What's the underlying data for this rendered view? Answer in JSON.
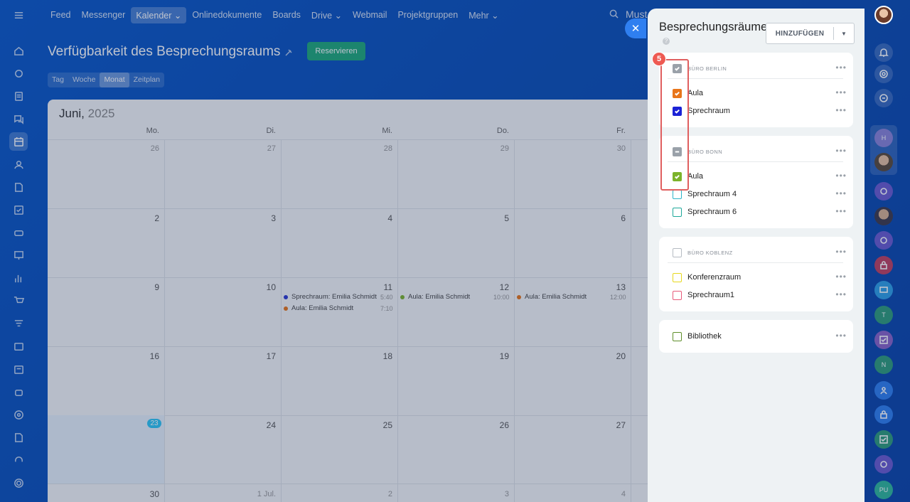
{
  "topnav": {
    "items": [
      {
        "label": "Feed"
      },
      {
        "label": "Messenger"
      },
      {
        "label": "Kalender ⌄",
        "active": true
      },
      {
        "label": "Onlinedokumente"
      },
      {
        "label": "Boards"
      },
      {
        "label": "Drive ⌄"
      },
      {
        "label": "Webmail"
      },
      {
        "label": "Projektgruppen"
      },
      {
        "label": "Mehr ⌄"
      }
    ],
    "search_text": "Must"
  },
  "page": {
    "title": "Verfügbarkeit des Besprechungsraums",
    "reserve_label": "Reservieren",
    "view_tabs": [
      "Tag",
      "Woche",
      "Monat",
      "Zeitplan"
    ],
    "active_view": "Monat"
  },
  "calendar": {
    "month": "Juni,",
    "year": "2025",
    "weekdays": [
      "Mo.",
      "Di.",
      "Mi.",
      "Do.",
      "Fr."
    ],
    "weeks": [
      [
        "26",
        "27",
        "28",
        "29",
        "30"
      ],
      [
        "2",
        "3",
        "4",
        "5",
        "6"
      ],
      [
        "9",
        "10",
        "11",
        "12",
        "13"
      ],
      [
        "16",
        "17",
        "18",
        "19",
        "20"
      ],
      [
        "23",
        "24",
        "25",
        "26",
        "27"
      ],
      [
        "30",
        "1 Jul.",
        "2",
        "3",
        "4"
      ]
    ],
    "today": "23",
    "events": [
      {
        "label": "Sprechraum: Emilia Schmidt",
        "time": "5:40",
        "color": "#2d3ad1"
      },
      {
        "label": "Aula: Emilia Schmidt",
        "time": "7:10",
        "color": "#e8751a"
      },
      {
        "label": "Aula: Emilia Schmidt",
        "time": "10:00",
        "color": "#7cb32b"
      },
      {
        "label": "Aula: Emilia Schmidt",
        "time": "12:00",
        "color": "#e8751a"
      }
    ]
  },
  "panel": {
    "title": "Besprechungsräume",
    "add_label": "HINZUFÜGEN",
    "step_number": "5",
    "sections": [
      {
        "name": "BÜRO BERLIN",
        "state": "checked",
        "rooms": [
          {
            "label": "Aula",
            "color": "#e8751a",
            "checked": true
          },
          {
            "label": "Sprechraum",
            "color": "#1b22d6",
            "checked": true
          }
        ]
      },
      {
        "name": "BÜRO BONN",
        "state": "partial",
        "rooms": [
          {
            "label": "Aula",
            "color": "#7cb32b",
            "checked": true
          },
          {
            "label": "Sprechraum 4",
            "color": "#2eb4c8",
            "checked": false
          },
          {
            "label": "Sprechraum 6",
            "color": "#1ea89a",
            "checked": false
          }
        ]
      },
      {
        "name": "BÜRO KOBLENZ",
        "state": "unchecked",
        "rooms": [
          {
            "label": "Konferenzraum",
            "color": "#e7d81e",
            "checked": false
          },
          {
            "label": "Sprechraum1",
            "color": "#e85a7a",
            "checked": false
          }
        ]
      },
      {
        "name": "",
        "state": "none",
        "rooms": [
          {
            "label": "Bibliothek",
            "color": "#5f8f2a",
            "checked": false
          }
        ]
      }
    ]
  },
  "right_rail": {
    "initials": [
      "H",
      "T",
      "N",
      "PU"
    ]
  }
}
